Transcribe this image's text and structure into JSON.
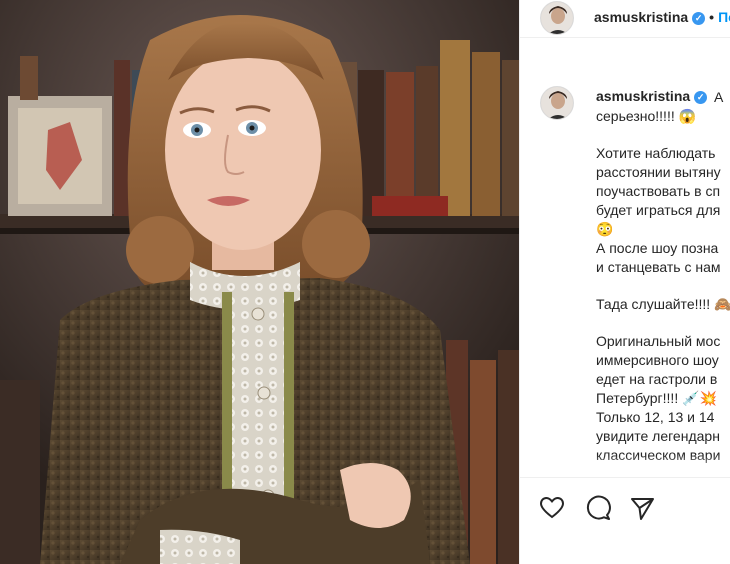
{
  "post": {
    "username": "asmuskristina",
    "verified": true,
    "follow_label": "Подписаться",
    "separator": "•"
  },
  "caption": {
    "username": "asmuskristina",
    "lines": [
      "А",
      "серьезно!!!!! 😱",
      "",
      "Хотите наблюдать",
      "расстоянии вытяну",
      "поучаствовать в сп",
      "будет играться для",
      "😳",
      "А после шоу позна",
      "и станцевать с нам",
      "",
      "Тада слушайте!!!! 🙈",
      "",
      "Оригинальный мос",
      "иммерсивного шоу",
      "едет на гастроли в",
      "Петербург!!!! 💉💥",
      "Только 12, 13 и 14",
      "увидите легендарн",
      "классическом вари"
    ]
  },
  "actions": {
    "like": "heart-icon",
    "comment": "comment-icon",
    "share": "share-icon"
  },
  "colors": {
    "verified": "#3897f0",
    "link": "#0095f6",
    "border": "#efefef"
  }
}
